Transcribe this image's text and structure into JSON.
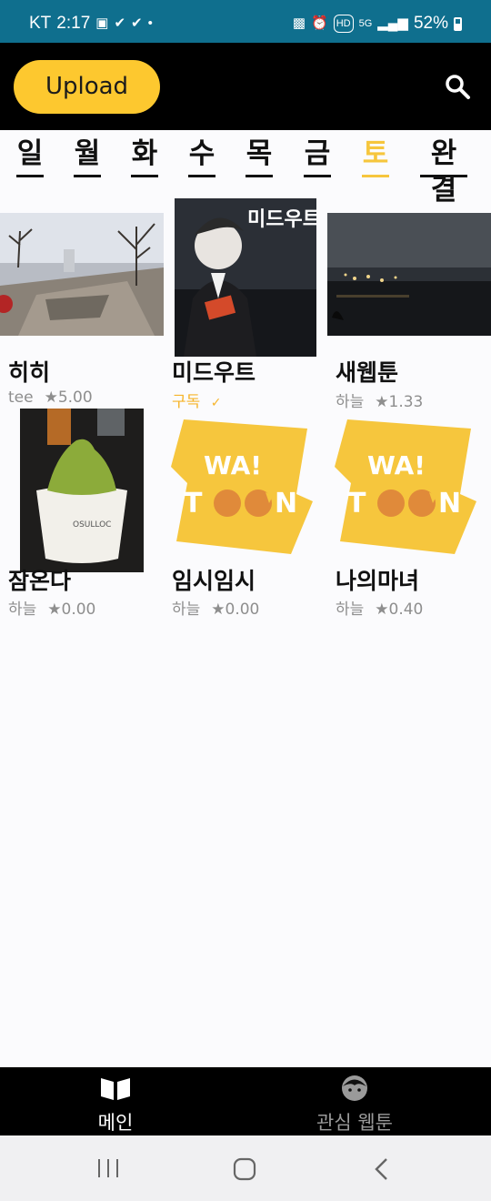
{
  "status_bar": {
    "carrier": "KT",
    "time": "2:17",
    "network": "5G",
    "hd": "HD",
    "battery": "52%"
  },
  "header": {
    "upload_label": "Upload"
  },
  "days": [
    {
      "label": "일"
    },
    {
      "label": "월"
    },
    {
      "label": "화"
    },
    {
      "label": "수"
    },
    {
      "label": "목"
    },
    {
      "label": "금"
    },
    {
      "label": "토"
    },
    {
      "label": "완결"
    }
  ],
  "active_day": "토",
  "webtoons": [
    {
      "title": "히히",
      "author": "tee",
      "rating": "★5.00"
    },
    {
      "title": "미드우트",
      "subscribed": "구독",
      "check": "✓"
    },
    {
      "title": "새웹툰",
      "author": "하늘",
      "rating": "★1.33"
    },
    {
      "title": "잠온다",
      "author": "하늘",
      "rating": "★0.00"
    },
    {
      "title": "임시임시",
      "author": "하늘",
      "rating": "★0.00",
      "logo_text": "WA! TOON"
    },
    {
      "title": "나의마녀",
      "author": "하늘",
      "rating": "★0.40",
      "logo_text": "WA! TOON"
    }
  ],
  "cover_text": "미드우트",
  "bottom_nav": {
    "main_label": "메인",
    "favorites_label": "관심 웹툰"
  },
  "colors": {
    "accent": "#fdc82f",
    "status_bar": "#0f6f8e",
    "header_bg": "#000000"
  }
}
